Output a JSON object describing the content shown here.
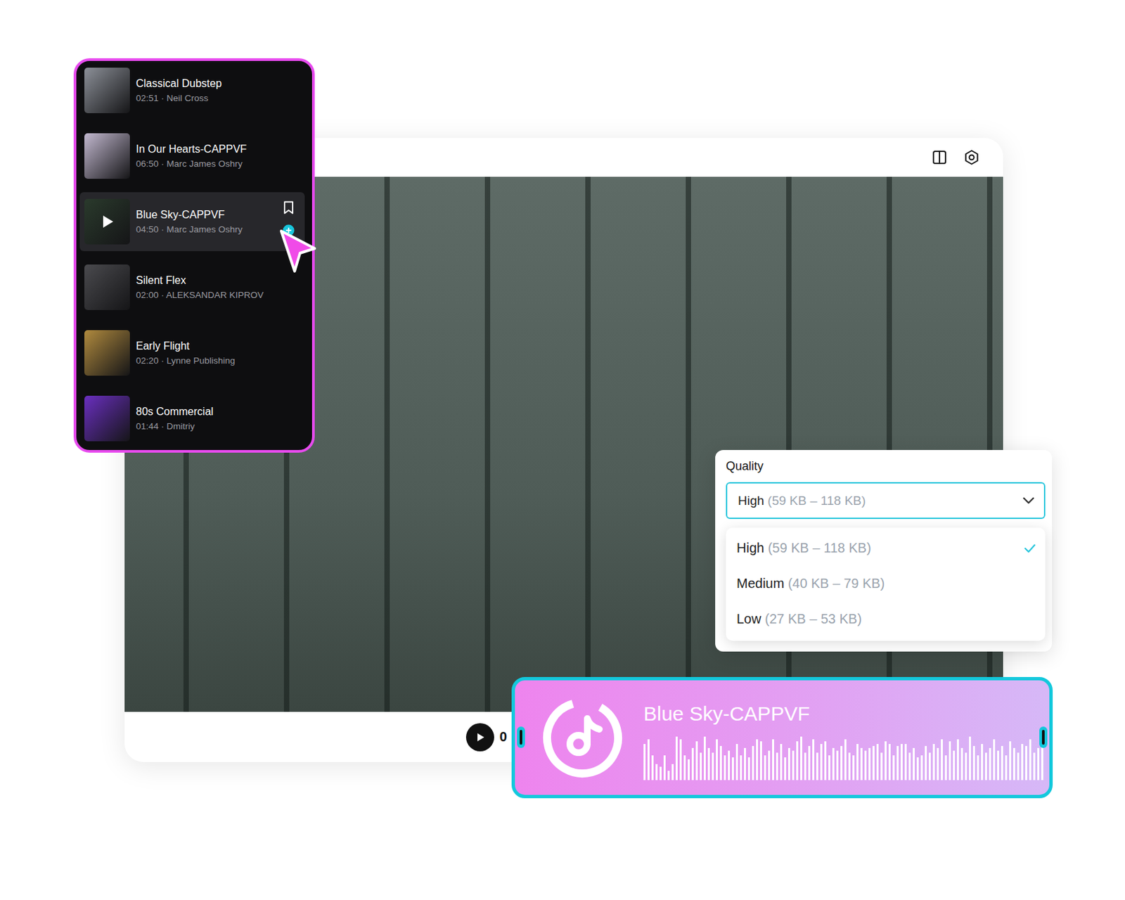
{
  "playlist": {
    "tracks": [
      {
        "title": "Classical Dubstep",
        "meta": "02:51 · Neil Cross",
        "selected": false,
        "color": "#8c9098"
      },
      {
        "title": "In Our Hearts-CAPPVF",
        "meta": "06:50 · Marc James Oshry",
        "selected": false,
        "color": "#c2b8cf"
      },
      {
        "title": "Blue Sky-CAPPVF",
        "meta": "04:50 · Marc James Oshry",
        "selected": true,
        "color": "#2a3a2c"
      },
      {
        "title": "Silent Flex",
        "meta": "02:00 · ALEKSANDAR KIPROV",
        "selected": false,
        "color": "#4a4a4e"
      },
      {
        "title": "Early Flight",
        "meta": "02:20 · Lynne Publishing",
        "selected": false,
        "color": "#b08a3e"
      },
      {
        "title": "80s Commercial",
        "meta": "01:44 · Dmitriy",
        "selected": false,
        "color": "#6a2fc0"
      }
    ]
  },
  "player": {
    "time": "0"
  },
  "quality": {
    "label": "Quality",
    "value": "High",
    "value_range": "(59 KB – 118 KB)",
    "options": [
      {
        "label": "High",
        "range": "(59 KB – 118 KB)",
        "selected": true
      },
      {
        "label": "Medium",
        "range": "(40 KB – 79 KB)",
        "selected": false
      },
      {
        "label": "Low",
        "range": "(27 KB – 53 KB)",
        "selected": false
      }
    ]
  },
  "now_playing": {
    "title": "Blue Sky-CAPPVF",
    "waveform": [
      0.8,
      0.9,
      0.55,
      0.35,
      0.3,
      0.55,
      0.2,
      0.35,
      0.95,
      0.9,
      0.55,
      0.45,
      0.7,
      0.85,
      0.6,
      0.95,
      0.7,
      0.6,
      0.9,
      0.75,
      0.55,
      0.65,
      0.5,
      0.8,
      0.55,
      0.7,
      0.5,
      0.75,
      0.9,
      0.85,
      0.55,
      0.65,
      0.9,
      0.6,
      0.8,
      0.5,
      0.7,
      0.65,
      0.85,
      0.95,
      0.6,
      0.75,
      0.9,
      0.6,
      0.8,
      0.85,
      0.55,
      0.7,
      0.65,
      0.75,
      0.9,
      0.6,
      0.55,
      0.8,
      0.7,
      0.65,
      0.7,
      0.75,
      0.8,
      0.6,
      0.85,
      0.8,
      0.55,
      0.75,
      0.8,
      0.8,
      0.6,
      0.7,
      0.5,
      0.55,
      0.75,
      0.6,
      0.8,
      0.7,
      0.9,
      0.55,
      0.85,
      0.65,
      0.9,
      0.7,
      0.6,
      0.95,
      0.75,
      0.55,
      0.8,
      0.6,
      0.7,
      0.9,
      0.65,
      0.75,
      0.55,
      0.85,
      0.7,
      0.6,
      0.8,
      0.75,
      0.9,
      0.6,
      0.7,
      0.8
    ]
  }
}
